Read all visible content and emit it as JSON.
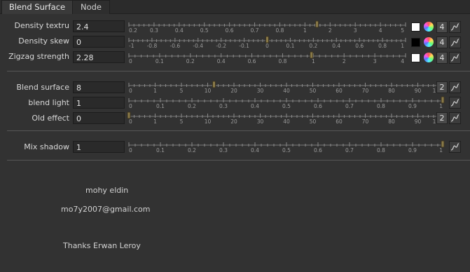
{
  "tabs": [
    {
      "label": "Blend Surface",
      "active": true
    },
    {
      "label": "Node",
      "active": false
    }
  ],
  "rows": [
    {
      "label": "Density textru",
      "value": "2.4",
      "slider_fraction": 0.68,
      "ticks": [
        "0.2",
        "0.3",
        "0.4",
        "0.5",
        "0.6",
        "0.7",
        "0.8",
        "1",
        "2",
        "3",
        "4",
        "5"
      ],
      "swatch_color": "#ffffff",
      "anim_count": "4"
    },
    {
      "label": "Density skew",
      "value": "0",
      "slider_fraction": 0.5,
      "ticks": [
        "-1",
        "-0.8",
        "-0.6",
        "-0.4",
        "-0.2",
        "-0.1",
        "0",
        "0.1",
        "0.2",
        "0.4",
        "0.6",
        "0.8",
        "1"
      ],
      "swatch_color": "#000000",
      "anim_count": "4"
    },
    {
      "label": "Zigzag strength",
      "value": "2.28",
      "slider_fraction": 0.66,
      "ticks": [
        "0",
        "0.1",
        "0.2",
        "0.4",
        "0.6",
        "0.8",
        "1",
        "2",
        "3",
        "4"
      ],
      "swatch_color": "#ffffff",
      "anim_count": "4"
    },
    {
      "label": "Blend surface",
      "value": "8",
      "slider_fraction": 0.27,
      "ticks": [
        "0",
        "1",
        "5",
        "10",
        "20",
        "30",
        "40",
        "50",
        "60",
        "70",
        "80",
        "90",
        "100"
      ],
      "anim_count": "2"
    },
    {
      "label": "blend light",
      "value": "1",
      "slider_fraction": 1.0,
      "ticks": [
        "0",
        "0.1",
        "0.2",
        "0.3",
        "0.4",
        "0.5",
        "0.6",
        "0.7",
        "0.8",
        "0.9",
        "1"
      ]
    },
    {
      "label": "Old effect",
      "value": "0",
      "slider_fraction": 0.0,
      "ticks": [
        "0",
        "1",
        "5",
        "10",
        "20",
        "30",
        "40",
        "50",
        "60",
        "70",
        "80",
        "90",
        "100"
      ],
      "anim_count": "2"
    },
    {
      "label": "Mix shadow",
      "value": "1",
      "slider_fraction": 1.0,
      "ticks": [
        "0",
        "0.1",
        "0.2",
        "0.3",
        "0.4",
        "0.5",
        "0.6",
        "0.7",
        "0.8",
        "0.9",
        "1"
      ]
    }
  ],
  "footer": {
    "author": "mohy eldin",
    "email": "mo7y2007@gmail.com",
    "thanks": "Thanks  Erwan Leroy"
  },
  "colors": {
    "background": "#323232",
    "field": "#2a2a2a",
    "knob": "#8a7a48",
    "tick": "#909090"
  },
  "icons": {
    "color_wheel": "color-wheel-icon",
    "curve": "curve-icon"
  }
}
